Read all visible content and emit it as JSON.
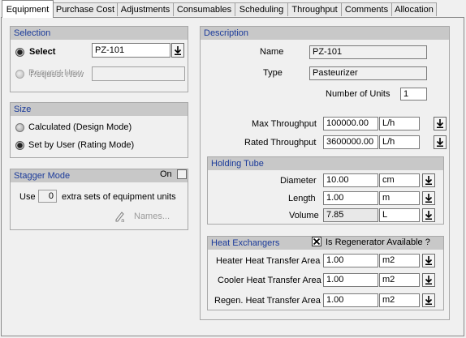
{
  "tabs": [
    "Equipment",
    "Purchase Cost",
    "Adjustments",
    "Consumables",
    "Scheduling",
    "Throughput",
    "Comments",
    "Allocation"
  ],
  "selection": {
    "header": "Selection",
    "select_label": "Select",
    "select_value": "PZ-101",
    "request_new_label": "Request New",
    "request_new_value": ""
  },
  "size": {
    "header": "Size",
    "calculated_label": "Calculated (Design Mode)",
    "set_by_user_label": "Set by User (Rating Mode)"
  },
  "stagger": {
    "header": "Stagger Mode",
    "on_label": "On",
    "use_label": "Use",
    "count": "0",
    "extra_label": "extra sets of equipment units",
    "names_label": "Names..."
  },
  "description": {
    "header": "Description",
    "name_label": "Name",
    "name_value": "PZ-101",
    "type_label": "Type",
    "type_value": "Pasteurizer",
    "units_label": "Number of Units",
    "units_value": "1",
    "max_label": "Max Throughput",
    "max_value": "100000.00",
    "max_unit": "L/h",
    "rated_label": "Rated Throughput",
    "rated_value": "3600000.00",
    "rated_unit": "L/h"
  },
  "holding": {
    "header": "Holding Tube",
    "diameter_label": "Diameter",
    "diameter_value": "10.00",
    "diameter_unit": "cm",
    "length_label": "Length",
    "length_value": "1.00",
    "length_unit": "m",
    "volume_label": "Volume",
    "volume_value": "7.85",
    "volume_unit": "L"
  },
  "hx": {
    "header": "Heat Exchangers",
    "regen_label": "Is Regenerator Available ?",
    "heater_label": "Heater Heat Transfer Area",
    "heater_value": "1.00",
    "heater_unit": "m2",
    "cooler_label": "Cooler Heat Transfer Area",
    "cooler_value": "1.00",
    "cooler_unit": "m2",
    "regen_area_label": "Regen. Heat Transfer Area",
    "regen_area_value": "1.00",
    "regen_area_unit": "m2"
  }
}
